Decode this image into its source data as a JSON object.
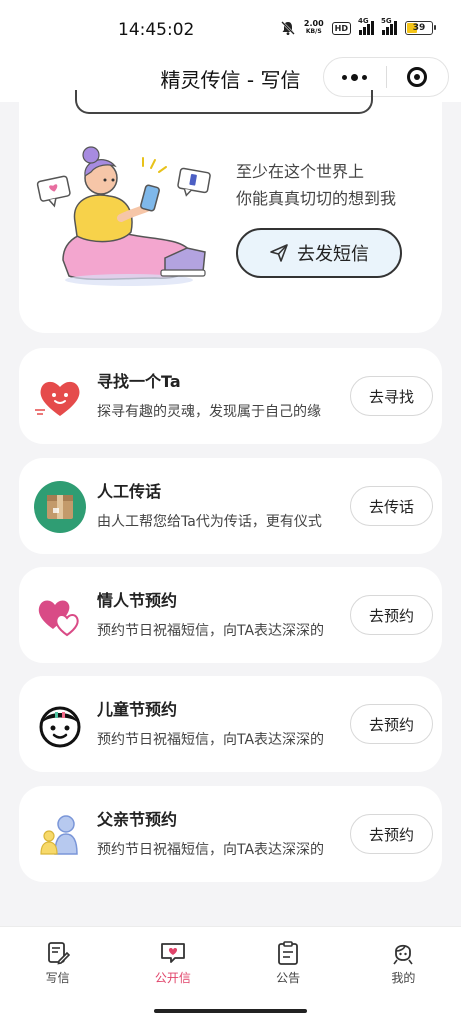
{
  "status_bar": {
    "time": "14:45:02",
    "net_speed": "2.00",
    "net_unit": "KB/S",
    "hd": "HD",
    "sig1_tag": "4G",
    "sig2_tag": "5G",
    "battery": "39",
    "battery_level": 0.39
  },
  "nav": {
    "title": "精灵传信 - 写信"
  },
  "hero": {
    "line1": "至少在这个世界上",
    "line2": "你能真真切切的想到我",
    "button_label": "去发短信"
  },
  "features": [
    {
      "title": "寻找一个Ta",
      "desc": "探寻有趣的灵魂，发现属于自己的缘",
      "button": "去寻找",
      "icon": "heart-icon"
    },
    {
      "title": "人工传话",
      "desc": "由人工帮您给Ta代为传话，更有仪式",
      "button": "去传话",
      "icon": "parcel-icon"
    },
    {
      "title": "情人节预约",
      "desc": "预约节日祝福短信，向TA表达深深的",
      "button": "去预约",
      "icon": "double-heart-icon"
    },
    {
      "title": "儿童节预约",
      "desc": "预约节日祝福短信，向TA表达深深的",
      "button": "去预约",
      "icon": "child-face-icon"
    },
    {
      "title": "父亲节预约",
      "desc": "预约节日祝福短信，向TA表达深深的",
      "button": "去预约",
      "icon": "father-child-icon"
    }
  ],
  "tabs": [
    {
      "label": "写信",
      "icon": "write-letter-icon"
    },
    {
      "label": "公开信",
      "icon": "public-letter-icon"
    },
    {
      "label": "公告",
      "icon": "notice-icon"
    },
    {
      "label": "我的",
      "icon": "profile-icon"
    }
  ],
  "colors": {
    "accent": "#e0446a",
    "hero_button_bg": "#eaf4fb",
    "battery": "#f5c518"
  }
}
